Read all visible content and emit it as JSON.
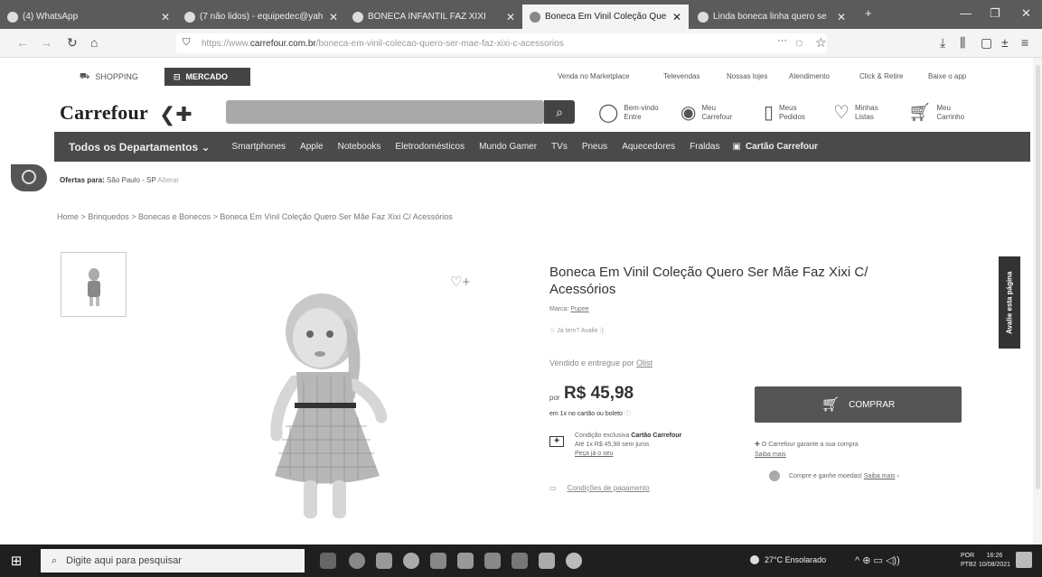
{
  "browser": {
    "tabs": [
      {
        "label": "(4) WhatsApp"
      },
      {
        "label": "(7 não lidos) - equipedec@yah"
      },
      {
        "label": "BONECA INFANTIL FAZ XIXI"
      },
      {
        "label": "Boneca Em Vinil Coleção Que"
      },
      {
        "label": "Linda boneca linha quero se"
      }
    ],
    "url_prefix": "https://www.",
    "url_host": "carrefour.com.br",
    "url_rest": "/boneca-em-vinil-colecao-quero-ser-mae-faz-xixi-c-acessorios"
  },
  "site": {
    "tab_shopping": "SHOPPING",
    "tab_mercado": "MERCADO",
    "top_links": [
      "Venda no Marketplace",
      "Televendas",
      "Nossas lojes",
      "Atendimento",
      "Click & Retire",
      "Baixe o app"
    ],
    "logo": "Carrefour",
    "search_placeholder": "",
    "account_line1": "Bem-vindo",
    "account_line2": "Entre",
    "my_carrefour_1": "Meu",
    "my_carrefour_2": "Carrefour",
    "orders_1": "Meus",
    "orders_2": "Pedidos",
    "lists_1": "Minhas",
    "lists_2": "Listas",
    "cart_1": "Meu",
    "cart_2": "Carrinho"
  },
  "categories": {
    "all": "Todos os Departamentos",
    "items": [
      "Smartphones",
      "Apple",
      "Notebooks",
      "Eletrodomésticos",
      "Mundo Gamer",
      "TVs",
      "Pneus",
      "Aquecedores",
      "Fraldas"
    ],
    "card": "Cartão Carrefour"
  },
  "offers": {
    "label": "Ofertas para:",
    "location": "São Paulo - SP",
    "change": "Alterar"
  },
  "breadcrumb": "Home  >  Brinquedos  >  Bonecas e Bonecos  >  Boneca Em Vinil Coleção Quero Ser Mãe Faz Xixi C/ Acessórios",
  "product": {
    "title": "Boneca Em Vinil Coleção Quero Ser Mãe Faz Xixi C/ Acessórios",
    "brand_label": "Marca:",
    "brand": "Pupee",
    "rating_text": "Já tem? Avalie :)",
    "seller_label": "Vendido e entregue por",
    "seller": "Olist",
    "price_prefix": "por",
    "price": "R$ 45,98",
    "installment": "em 1x no cartão ou boleto",
    "card_line1": "Condição exclusiva",
    "card_name": "Cartão Carrefour",
    "card_line2": "Até 1x R$ 45,98 sem juros",
    "card_link": "Peça já o seu",
    "payment_conditions": "Condições de pagamento",
    "buy": "COMPRAR",
    "guarantee": "O Carrefour garante a sua compra",
    "guarantee_link": "Saiba mais",
    "coins_text": "Compre e ganhe moedas!",
    "coins_link": "Saiba mais",
    "feedback": "Avalie esta página"
  },
  "taskbar": {
    "search_placeholder": "Digite aqui para pesquisar",
    "weather": "27°C  Ensolarado",
    "lang1": "POR",
    "lang2": "PTB2",
    "time": "16:26",
    "date": "10/08/2021"
  }
}
